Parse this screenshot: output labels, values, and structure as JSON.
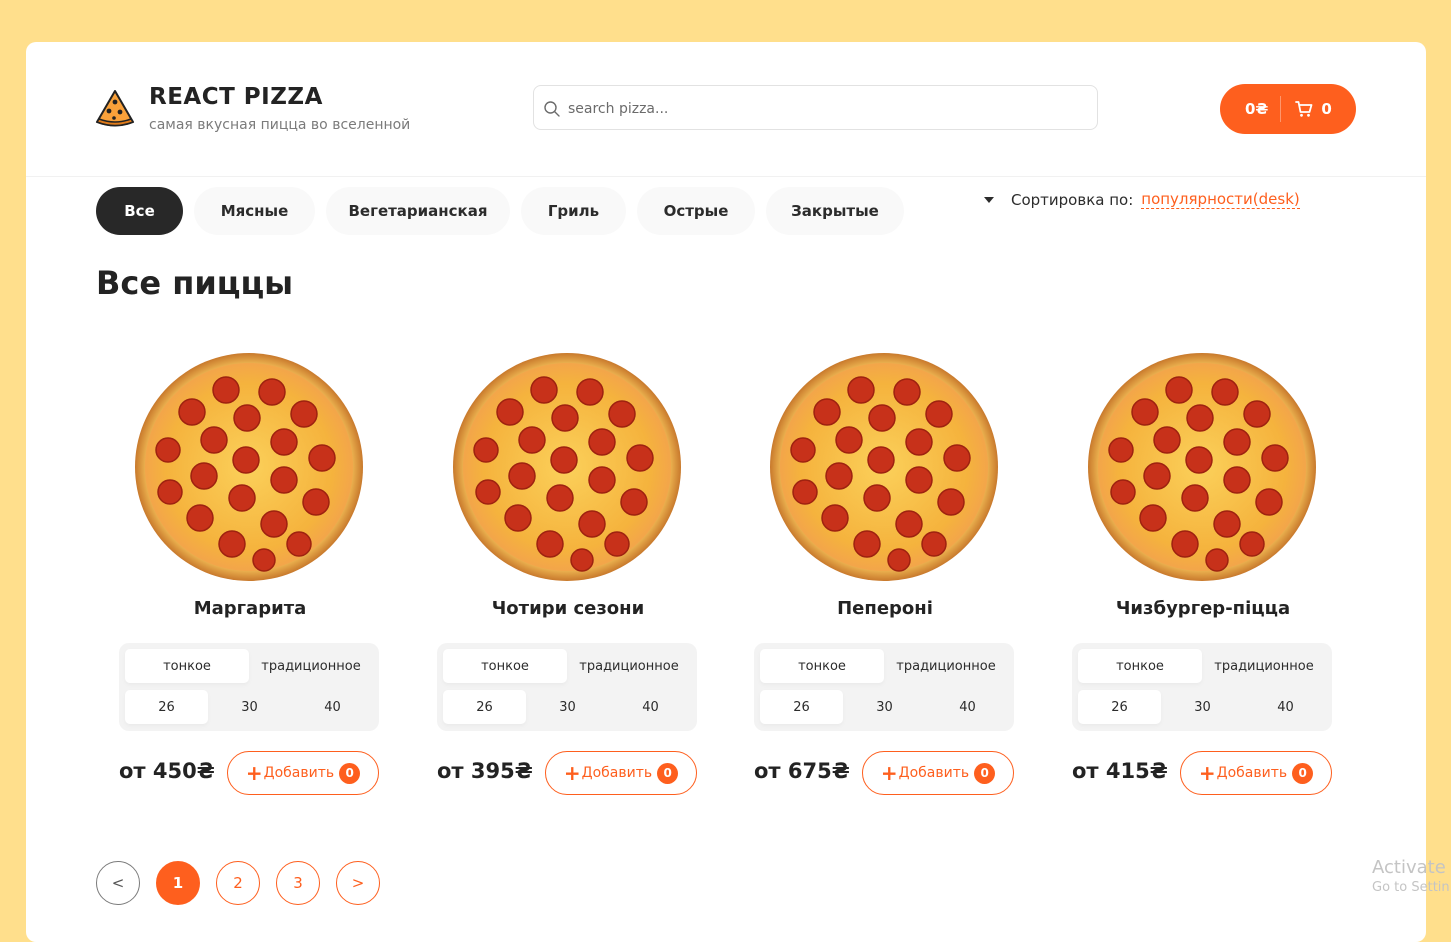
{
  "header": {
    "logo_title": "REACT PIZZA",
    "logo_subtitle": "самая вкусная пицца во вселенной",
    "search_placeholder": "search pizza...",
    "cart_total": "0₴",
    "cart_count": "0"
  },
  "categories": [
    "Все",
    "Мясные",
    "Вегетарианская",
    "Гриль",
    "Острые",
    "Закрытые"
  ],
  "active_category": "Все",
  "sort": {
    "label": "Сортировка по:",
    "value": "популярности(desk)"
  },
  "page_title": "Все пиццы",
  "pizzas": [
    {
      "name": "Маргарита",
      "types": [
        "тонкое",
        "традиционное"
      ],
      "sizes": [
        "26",
        "30",
        "40"
      ],
      "price": "от 450₴",
      "add_label": "Добавить",
      "count": "0"
    },
    {
      "name": "Чотири сезони",
      "types": [
        "тонкое",
        "традиционное"
      ],
      "sizes": [
        "26",
        "30",
        "40"
      ],
      "price": "от 395₴",
      "add_label": "Добавить",
      "count": "0"
    },
    {
      "name": "Пепероні",
      "types": [
        "тонкое",
        "традиционное"
      ],
      "sizes": [
        "26",
        "30",
        "40"
      ],
      "price": "от 675₴",
      "add_label": "Добавить",
      "count": "0"
    },
    {
      "name": "Чизбургер-піцца",
      "types": [
        "тонкое",
        "традиционное"
      ],
      "sizes": [
        "26",
        "30",
        "40"
      ],
      "price": "от 415₴",
      "add_label": "Добавить",
      "count": "0"
    }
  ],
  "pagination": {
    "prev": "<",
    "pages": [
      "1",
      "2",
      "3"
    ],
    "next": ">",
    "current": "1"
  },
  "watermark": {
    "line1": "Activate W",
    "line2": "Go to Settin"
  },
  "colors": {
    "accent": "#FE5F1E",
    "background": "#FFDF8C",
    "dark": "#282828"
  }
}
